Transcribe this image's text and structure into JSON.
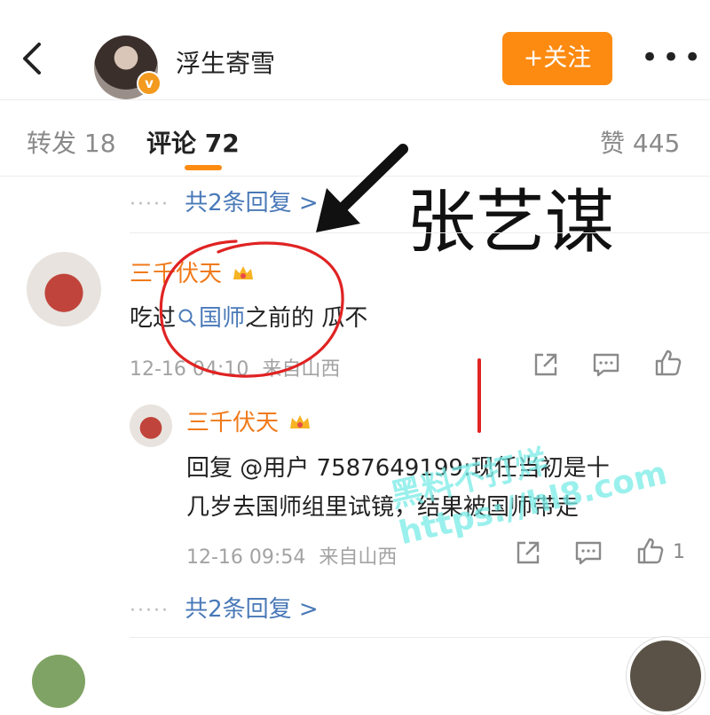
{
  "header": {
    "username": "浮生寄雪",
    "badge": "v",
    "follow_label": "+关注",
    "more_label": "•••"
  },
  "tabs": [
    {
      "label": "转发 18"
    },
    {
      "label": "评论 72"
    },
    {
      "label": "赞 445"
    }
  ],
  "top_reply_link": "共2条回复 >",
  "annotation": "张艺谋",
  "comment": {
    "name": "三千伏天",
    "text_pre": "吃过",
    "text_tag": "国师",
    "text_post": "之前的 瓜不",
    "time": "12-16 04:10",
    "location": "来自山西"
  },
  "reply": {
    "name": "三千伏天",
    "text_line1": "回复 @用户 7587649199:现任当初是十",
    "text_line2": "几岁去国师组里试镜，结果被国师带走",
    "time": "12-16 09:54",
    "location": "来自山西",
    "like_count": "1"
  },
  "bottom_reply_link": "共2条回复 >",
  "watermark": "黑料不打烊 https://hl8.com",
  "colors": {
    "accent": "#fd8b12",
    "link": "#4a79b8",
    "name": "#f07a1a"
  }
}
